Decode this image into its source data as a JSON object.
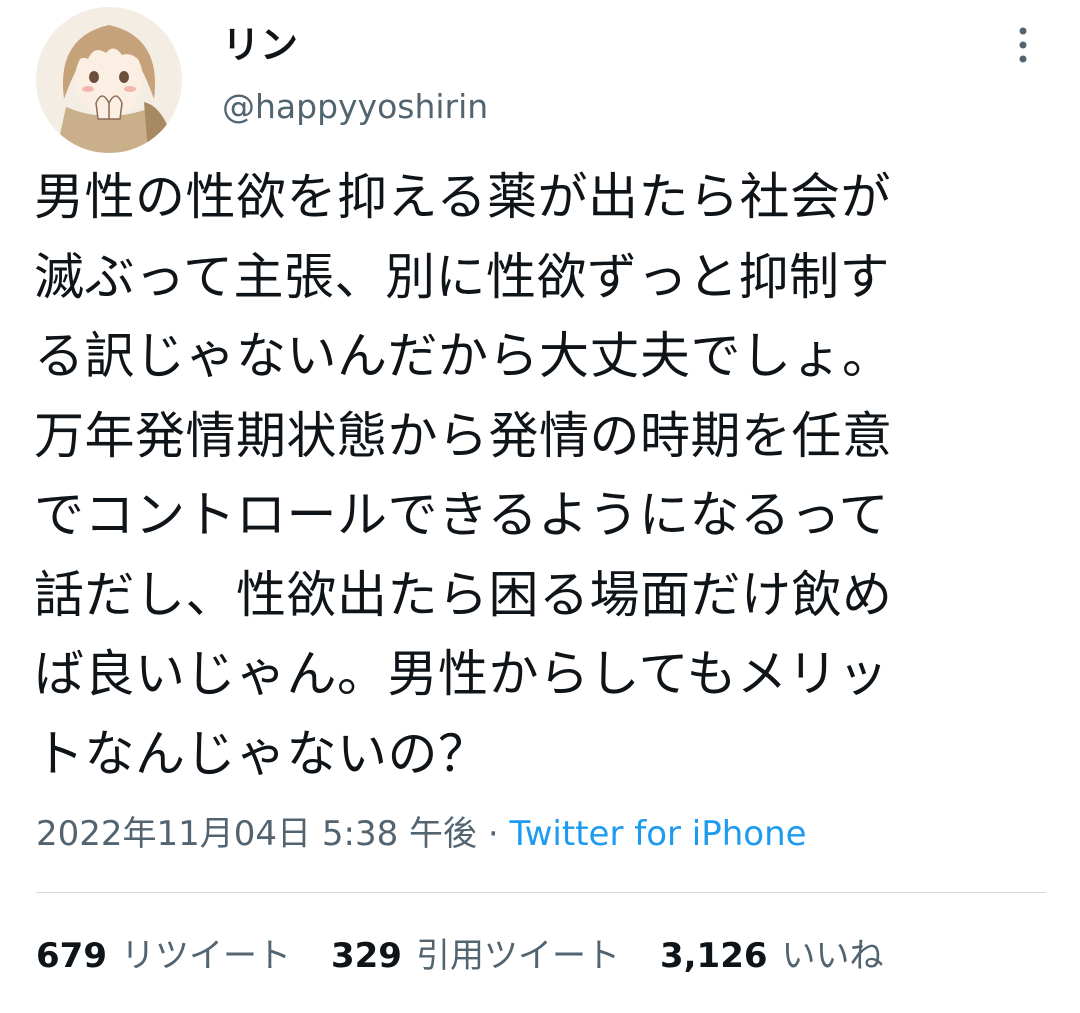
{
  "author": {
    "display_name": "リン",
    "username": "@happyyoshirin"
  },
  "tweet": {
    "text": "男性の性欲を抑える薬が出たら社会が\n滅ぶって主張、別に性欲ずっと抑制す\nる訳じゃないんだから大丈夫でしょ。\n万年発情期状態から発情の時期を任意\nでコントロールできるようになるって\n話だし、性欲出たら困る場面だけ飲め\nば良いじゃん。男性からしてもメリッ\nトなんじゃないの？",
    "timestamp": "2022年11月04日 5:38 午後",
    "separator": " · ",
    "source": "Twitter for iPhone"
  },
  "stats": {
    "retweets": {
      "count": "679",
      "label": "リツイート"
    },
    "quotes": {
      "count": "329",
      "label": "引用ツイート"
    },
    "likes": {
      "count": "3,126",
      "label": "いいね"
    }
  },
  "icons": {
    "more": "more-vertical-icon"
  },
  "colors": {
    "text_primary": "#0f1419",
    "text_secondary": "#536471",
    "link": "#1d9bf0",
    "divider": "#cfd9de"
  }
}
